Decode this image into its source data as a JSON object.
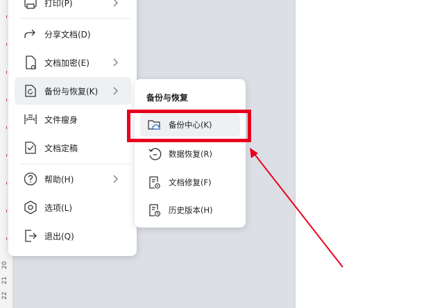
{
  "ruler": {
    "numbers": [
      "20",
      "21",
      "22"
    ]
  },
  "main_menu": {
    "items": [
      {
        "label": "打印(P)",
        "icon": "printer-icon",
        "has_submenu": true
      },
      {
        "label": "分享文档(D)",
        "icon": "share-icon",
        "has_submenu": false
      },
      {
        "label": "文档加密(E)",
        "icon": "document-lock-icon",
        "has_submenu": true
      },
      {
        "label": "备份与恢复(K)",
        "icon": "backup-restore-icon",
        "has_submenu": true,
        "active": true
      },
      {
        "label": "文件瘦身",
        "icon": "file-slim-icon",
        "has_submenu": false
      },
      {
        "label": "文档定稿",
        "icon": "document-finalize-icon",
        "has_submenu": false
      },
      {
        "label": "帮助(H)",
        "icon": "help-icon",
        "has_submenu": true
      },
      {
        "label": "选项(L)",
        "icon": "options-icon",
        "has_submenu": false
      },
      {
        "label": "退出(Q)",
        "icon": "exit-icon",
        "has_submenu": false
      }
    ]
  },
  "sub_menu": {
    "title": "备份与恢复",
    "items": [
      {
        "label": "备份中心(K)",
        "icon": "cloud-folder-icon",
        "active": true
      },
      {
        "label": "数据恢复(R)",
        "icon": "data-restore-icon"
      },
      {
        "label": "文档修复(F)",
        "icon": "document-repair-icon"
      },
      {
        "label": "历史版本(H)",
        "icon": "history-version-icon"
      }
    ]
  },
  "annotation": {
    "color": "#e8001e"
  }
}
